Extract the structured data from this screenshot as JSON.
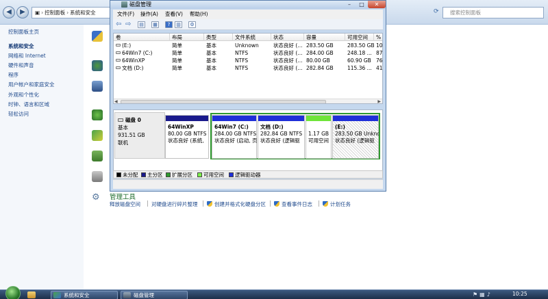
{
  "control_panel": {
    "address": [
      "控制面板",
      "系统和安全"
    ],
    "search_placeholder": "搜索控制面板",
    "sidebar": [
      {
        "label": "控制面板主页",
        "bold": false
      },
      {
        "label": "系统和安全",
        "bold": true
      },
      {
        "label": "网络和 Internet",
        "bold": false
      },
      {
        "label": "硬件和声音",
        "bold": false
      },
      {
        "label": "程序",
        "bold": false
      },
      {
        "label": "用户帐户和家庭安全",
        "bold": false
      },
      {
        "label": "外观和个性化",
        "bold": false
      },
      {
        "label": "时钟、语言和区域",
        "bold": false
      },
      {
        "label": "轻松访问",
        "bold": false
      }
    ],
    "admin_tools": {
      "title": "管理工具",
      "links": [
        "释放磁盘空间",
        "对硬盘进行碎片整理",
        "创建并格式化硬盘分区",
        "查看事件日志",
        "计划任务"
      ]
    }
  },
  "disk_mgmt": {
    "title": "磁盘管理",
    "menu": [
      "文件(F)",
      "操作(A)",
      "查看(V)",
      "帮助(H)"
    ],
    "columns": [
      "卷",
      "布局",
      "类型",
      "文件系统",
      "状态",
      "容量",
      "可用空间",
      "%"
    ],
    "volumes": [
      {
        "name": "(E:)",
        "layout": "简单",
        "type": "基本",
        "fs": "Unknown",
        "status": "状态良好 (...",
        "capacity": "283.50 GB",
        "free": "283.50 GB",
        "pct": "10"
      },
      {
        "name": "64Win7 (C:)",
        "layout": "简单",
        "type": "基本",
        "fs": "NTFS",
        "status": "状态良好 (...",
        "capacity": "284.00 GB",
        "free": "248.18 ...",
        "pct": "87"
      },
      {
        "name": "64WinXP",
        "layout": "简单",
        "type": "基本",
        "fs": "NTFS",
        "status": "状态良好 (...",
        "capacity": "80.00 GB",
        "free": "60.90 GB",
        "pct": "76"
      },
      {
        "name": "文档 (D:)",
        "layout": "简单",
        "type": "基本",
        "fs": "NTFS",
        "status": "状态良好 (...",
        "capacity": "282.84 GB",
        "free": "115.36 ...",
        "pct": "41"
      }
    ],
    "disk": {
      "name": "磁盘 0",
      "type": "基本",
      "size": "931.51 GB",
      "state": "联机"
    },
    "partitions": [
      {
        "name": "64WinXP",
        "size": "80.00 GB NTFS",
        "status": "状态良好 (系统,"
      },
      {
        "name": "64Win7  (C:)",
        "size": "284.00 GB NTFS",
        "status": "状态良好 (启动, 页"
      },
      {
        "name": "文档  (D:)",
        "size": "282.84 GB NTFS",
        "status": "状态良好 (逻辑驱"
      },
      {
        "name": "",
        "size": "1.17 GB",
        "status": "可用空间"
      },
      {
        "name": "(E:)",
        "size": "283.50 GB Unkno",
        "status": "状态良好 (逻辑驱"
      }
    ],
    "legend": [
      {
        "label": "未分配",
        "color": "#000000"
      },
      {
        "label": "主分区",
        "color": "#1a1a8c"
      },
      {
        "label": "扩展分区",
        "color": "#2f9a2f"
      },
      {
        "label": "可用空间",
        "color": "#7cf04a"
      },
      {
        "label": "逻辑驱动器",
        "color": "#1f2fd8"
      }
    ],
    "colors": {
      "primary_bar": "#1a1a8c",
      "logical_bar": "#1f2fd8",
      "free_bar": "#6fe43a",
      "extended_border": "#2f9a2f"
    }
  },
  "taskbar": {
    "buttons": [
      "系统和安全",
      "磁盘管理"
    ],
    "clock": "10:25"
  }
}
